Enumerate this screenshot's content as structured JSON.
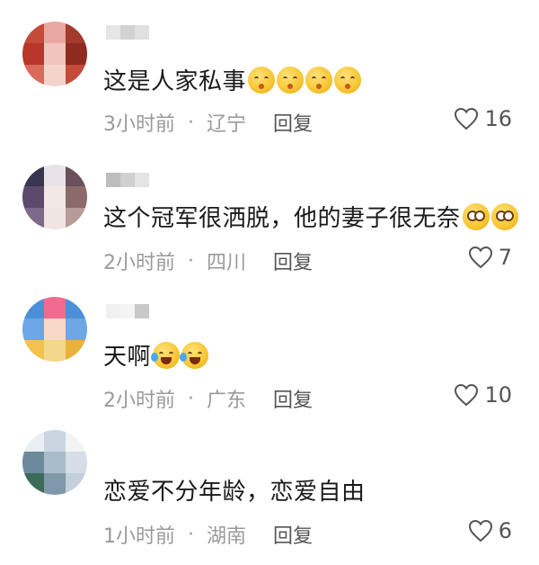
{
  "comments": [
    {
      "text": "这是人家私事",
      "emojis": [
        "pout",
        "pout",
        "pout",
        "pout"
      ],
      "time": "3小时前",
      "location": "辽宁",
      "reply_label": "回复",
      "likes": "16"
    },
    {
      "text": "这个冠军很洒脱，他的妻子很无奈",
      "emojis": [
        "roll",
        "roll"
      ],
      "time": "2小时前",
      "location": "四川",
      "reply_label": "回复",
      "likes": "7"
    },
    {
      "text": "天啊",
      "emojis": [
        "laugh",
        "laugh"
      ],
      "time": "2小时前",
      "location": "广东",
      "reply_label": "回复",
      "likes": "10"
    },
    {
      "text": "恋爱不分年龄，恋爱自由",
      "emojis": [],
      "time": "1小时前",
      "location": "湖南",
      "reply_label": "回复",
      "likes": "6"
    }
  ],
  "separator": "·",
  "colors": {
    "meta": "#9a9a9a",
    "text": "#1a1a1a",
    "emoji": "#f7c531"
  }
}
